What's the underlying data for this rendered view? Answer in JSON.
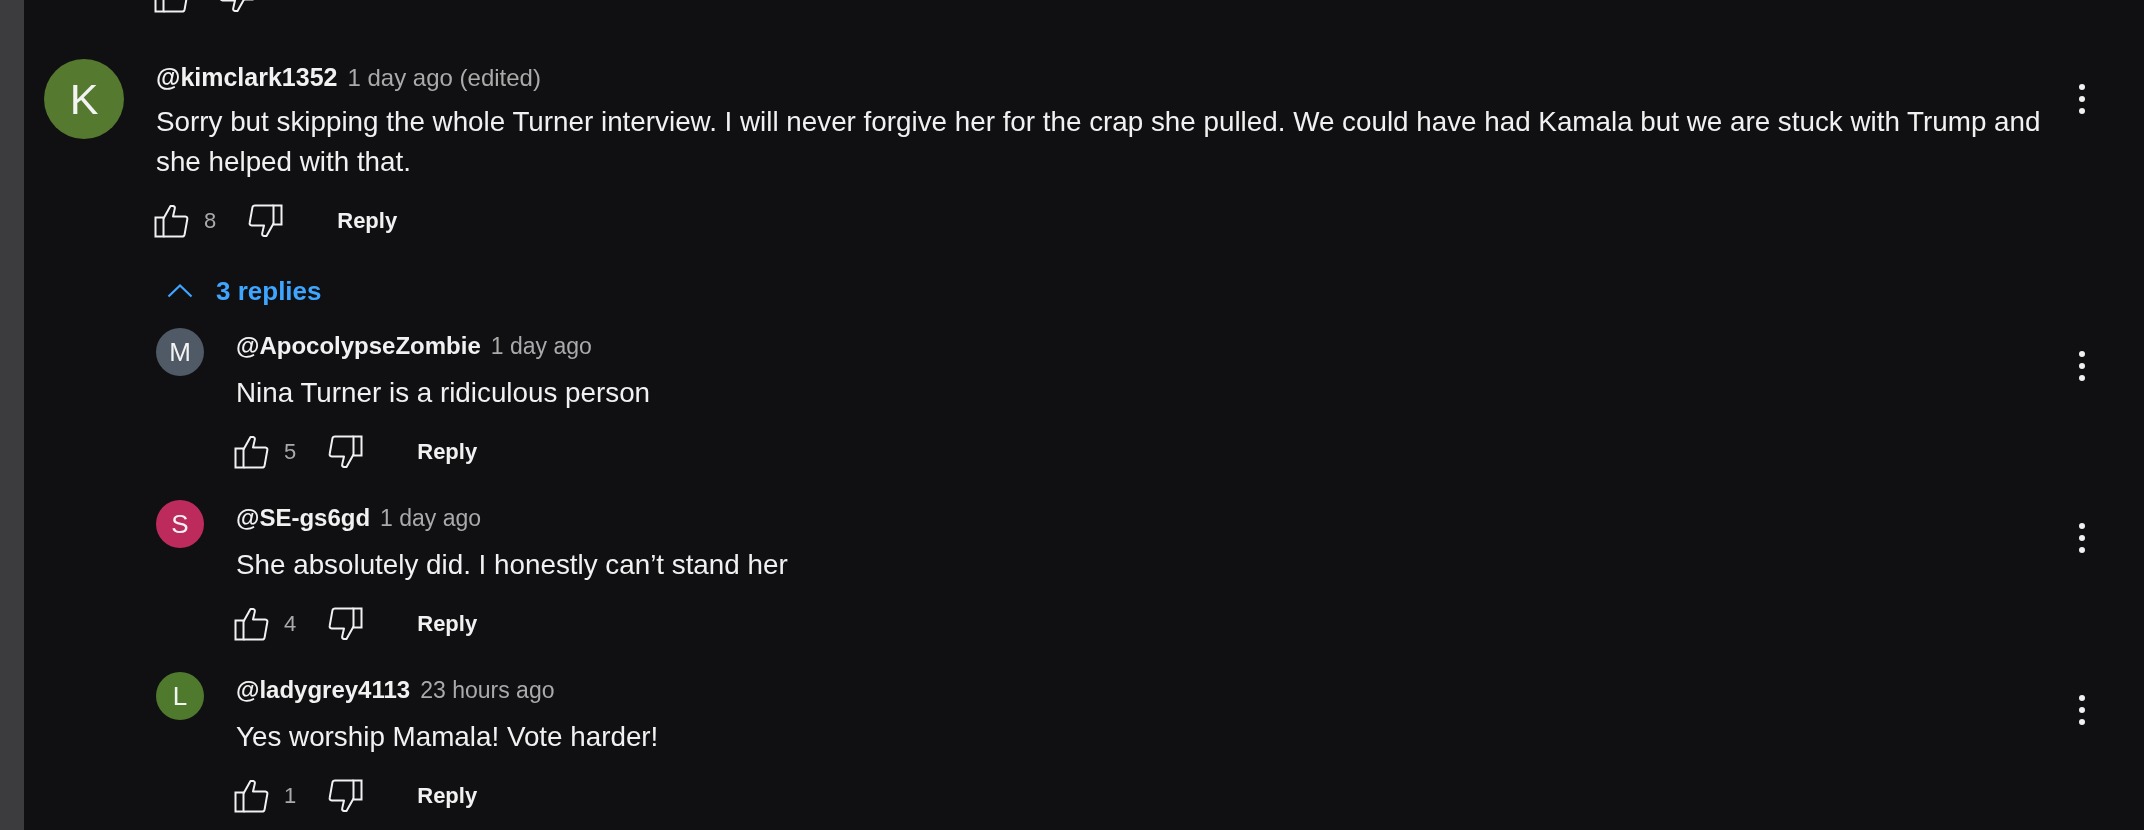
{
  "comment": {
    "avatar": {
      "letter": "K",
      "color": "#54792f"
    },
    "author": "@kimclark1352",
    "time": "1 day ago (edited)",
    "text": "Sorry but skipping the whole Turner interview. I will never forgive her for the crap she pulled. We could have had Kamala but we are stuck with Trump and she helped with that.",
    "likes": "8",
    "reply_label": "Reply"
  },
  "replies_toggle": {
    "label": "3 replies",
    "expanded": true
  },
  "replies": [
    {
      "avatar": {
        "letter": "M",
        "color": "#505966"
      },
      "author": "@ApocolypseZombie",
      "time": "1 day ago",
      "text": "Nina Turner is a ridiculous person",
      "likes": "5",
      "reply_label": "Reply"
    },
    {
      "avatar": {
        "letter": "S",
        "color": "#bd2b5d"
      },
      "author": "@SE-gs6gd",
      "time": "1 day ago",
      "text": "She absolutely did. I honestly can’t stand her",
      "likes": "4",
      "reply_label": "Reply"
    },
    {
      "avatar": {
        "letter": "L",
        "color": "#4f7a2d"
      },
      "author": "@ladygrey4113",
      "time": "23 hours ago",
      "text": "Yes worship Mamala! Vote harder!",
      "likes": "1",
      "reply_label": "Reply"
    }
  ]
}
